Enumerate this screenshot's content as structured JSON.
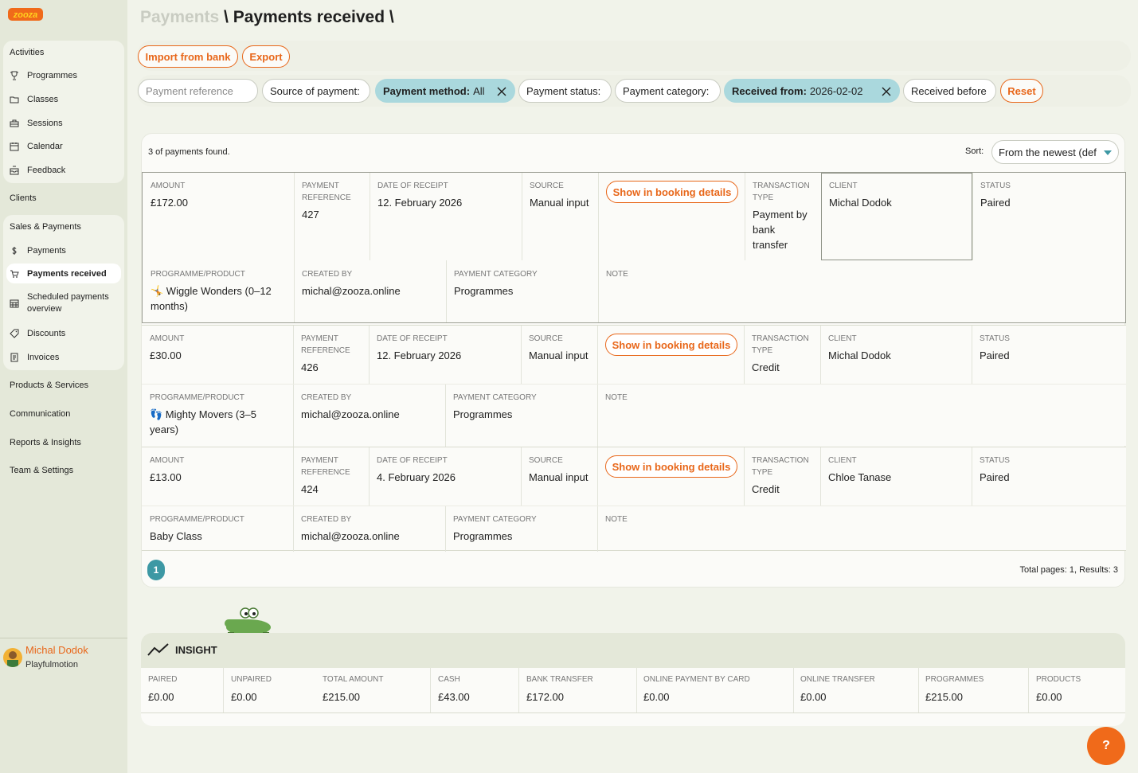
{
  "brand": {
    "logo_text": "zooza",
    "accent": "#e8671a",
    "teal": "#3d98a4"
  },
  "sidebar": {
    "activities_heading": "Activities",
    "activities": [
      {
        "label": "Programmes",
        "icon": "trophy-icon"
      },
      {
        "label": "Classes",
        "icon": "folder-icon"
      },
      {
        "label": "Sessions",
        "icon": "briefcase-icon"
      },
      {
        "label": "Calendar",
        "icon": "calendar-icon"
      },
      {
        "label": "Feedback",
        "icon": "inbox-icon"
      }
    ],
    "clients": "Clients",
    "sales_heading": "Sales & Payments",
    "sales": [
      {
        "label": "Payments",
        "icon": "dollar-icon"
      },
      {
        "label": "Payments received",
        "icon": "cart-icon"
      },
      {
        "label": "Scheduled payments overview",
        "icon": "calendar-grid-icon"
      },
      {
        "label": "Discounts",
        "icon": "tag-icon"
      },
      {
        "label": "Invoices",
        "icon": "invoice-icon"
      }
    ],
    "products": "Products & Services",
    "communication": "Communication",
    "reports": "Reports & Insights",
    "team": "Team & Settings",
    "user": {
      "name": "Michal Dodok",
      "org": "Playfulmotion"
    }
  },
  "header": {
    "crumb": "Payments",
    "sep1": " \\ ",
    "title": "Payments received",
    "sep2": " \\"
  },
  "actions": {
    "import": "Import from bank",
    "export": "Export"
  },
  "filters": {
    "reference_placeholder": "Payment reference",
    "source": "Source of payment:",
    "method_label": "Payment method:",
    "method_value": "All",
    "status": "Payment status:",
    "category": "Payment category:",
    "received_label": "Received from:",
    "received_value": "2026-02-02",
    "before": "Received before",
    "reset": "Reset"
  },
  "results": {
    "found": "3 of payments found.",
    "sort_label": "Sort:",
    "sort_value": "From the newest (def",
    "show_label": "Show in booking details",
    "labels": {
      "amount": "AMOUNT",
      "payment_reference": "PAYMENT REFERENCE",
      "date": "DATE OF RECEIPT",
      "source": "SOURCE",
      "transaction_type": "TRANSACTION TYPE",
      "client": "CLIENT",
      "status": "STATUS",
      "programme": "PROGRAMME/PRODUCT",
      "created_by": "CREATED BY",
      "category": "PAYMENT CATEGORY",
      "note": "NOTE"
    },
    "payments": [
      {
        "amount": "£172.00",
        "reference": "427",
        "date": "12. February 2026",
        "source": "Manual input",
        "transaction_type": "Payment by bank transfer",
        "client": "Michal Dodok",
        "status": "Paired",
        "programme": "🤸 Wiggle Wonders (0–12 months)",
        "created_by": "michal@zooza.online",
        "category": "Programmes",
        "note": ""
      },
      {
        "amount": "£30.00",
        "reference": "426",
        "date": "12. February 2026",
        "source": "Manual input",
        "transaction_type": "Credit",
        "client": "Michal Dodok",
        "status": "Paired",
        "programme": "👣 Mighty Movers (3–5 years)",
        "created_by": "michal@zooza.online",
        "category": "Programmes",
        "note": ""
      },
      {
        "amount": "£13.00",
        "reference": "424",
        "date": "4. February 2026",
        "source": "Manual input",
        "transaction_type": "Credit",
        "client": "Chloe Tanase",
        "status": "Paired",
        "programme": "Baby Class",
        "created_by": "michal@zooza.online",
        "category": "Programmes",
        "note": ""
      }
    ],
    "current_page": "1",
    "total": "Total pages: 1, Results: 3"
  },
  "insight": {
    "title": "INSIGHT",
    "cells": [
      {
        "label": "PAIRED",
        "value": "£0.00"
      },
      {
        "label": "UNPAIRED",
        "value": "£0.00"
      },
      {
        "label": "TOTAL AMOUNT",
        "value": "£215.00"
      },
      {
        "label": "CASH",
        "value": "£43.00"
      },
      {
        "label": "BANK TRANSFER",
        "value": "£172.00"
      },
      {
        "label": "ONLINE PAYMENT BY CARD",
        "value": "£0.00"
      },
      {
        "label": "ONLINE TRANSFER",
        "value": "£0.00"
      },
      {
        "label": "PROGRAMMES",
        "value": "£215.00"
      },
      {
        "label": "PRODUCTS",
        "value": "£0.00"
      }
    ]
  },
  "help": "?"
}
